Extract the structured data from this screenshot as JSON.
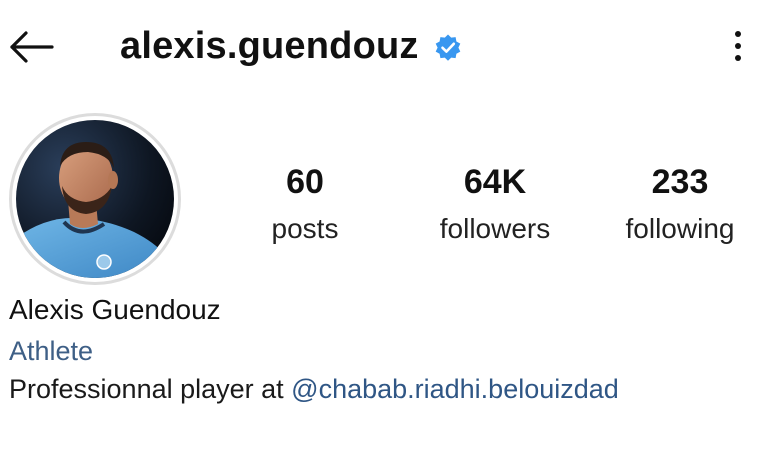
{
  "header": {
    "username": "alexis.guendouz",
    "verified": true,
    "back_icon": "arrow-left-icon",
    "more_icon": "more-vertical-icon",
    "verified_color": "#3897f0"
  },
  "stats": [
    {
      "value": "60",
      "label": "posts"
    },
    {
      "value": "64K",
      "label": "followers"
    },
    {
      "value": "233",
      "label": "following"
    }
  ],
  "profile": {
    "display_name": "Alexis Guendouz",
    "category": "Athlete",
    "bio_prefix": "Professionnal player at ",
    "bio_mention": "@chabab.riadhi.belouizdad",
    "link_color": "#2f5685"
  }
}
